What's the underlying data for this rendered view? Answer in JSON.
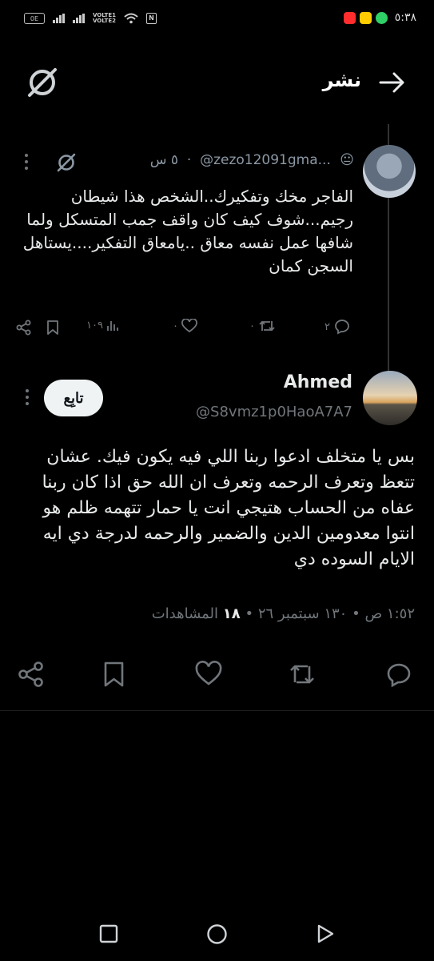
{
  "status_bar": {
    "battery": "0E",
    "volte1": "VOLTE1",
    "volte2": "VOLTE2",
    "nfc": "N",
    "time": "٥:٣٨",
    "app_colors": [
      "#ff2d2d",
      "#ffcc00",
      "#2fd066"
    ]
  },
  "header": {
    "title": "نشر",
    "back_icon": "arrow-right-icon",
    "logo_icon": "x-logo-icon"
  },
  "reply": {
    "handle": "@zezo12091gma...",
    "emoji": "😐",
    "time": "٥ س",
    "text": "الفاجر مخك وتفكيرك..الشخص هذا شيطان رجيم...شوف كيف كان واقف جمب المتسكل ولما شافها عمل نفسه معاق ..يامعاق التفكير....يستاهل السجن كمان",
    "replies": "٢",
    "retweets": "٠",
    "likes": "٠",
    "views": "١٠٩"
  },
  "main_post": {
    "author_name": "Ahmed",
    "author_handle": "@S8vmz1p0HaoA7A7",
    "follow_label": "تابِع",
    "text": "بس يا متخلف ادعوا ربنا اللي فيه يكون فيك. عشان تتعظ وتعرف الرحمه وتعرف ان الله حق اذا كان ربنا عفاه من الحساب هتيجي انت يا حمار تتهمه ظلم هو انتوا معدومين الدين والضمير والرحمه لدرجة دي ايه الايام السوده دي",
    "time": "١:٥٢ ص",
    "date": "١٣٠ سبتمبر ٢٦",
    "views_count": "١٨",
    "views_label": "المشاهدات"
  },
  "colors": {
    "background": "#000000",
    "text": "#e7e9ea",
    "muted": "#71767b"
  }
}
